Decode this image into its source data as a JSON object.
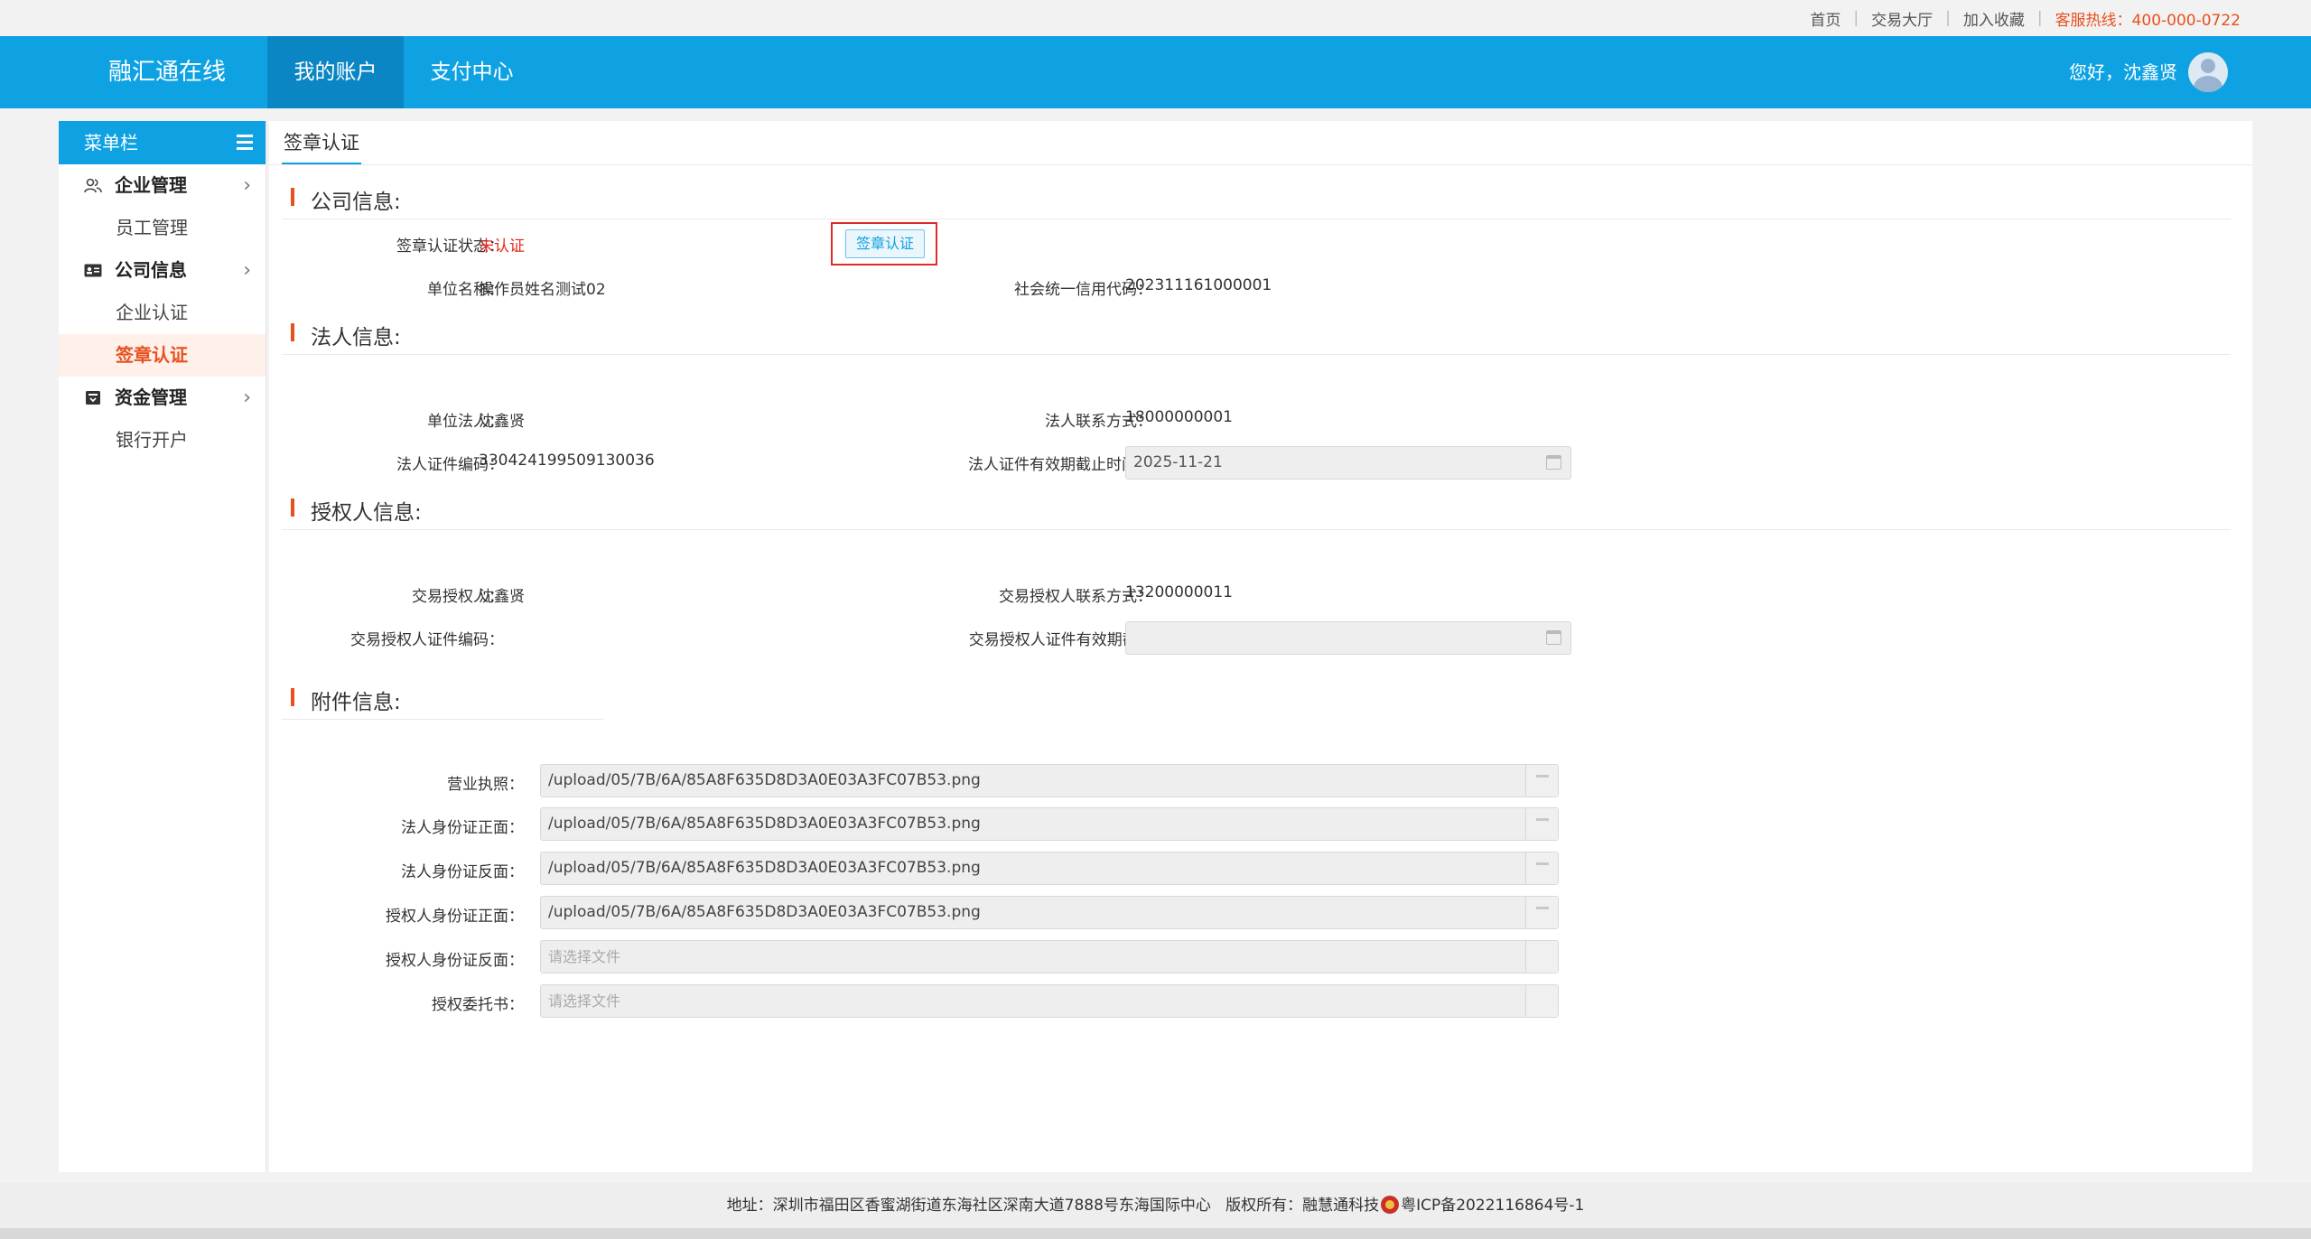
{
  "toplinks": {
    "home": "首页",
    "trading_hall": "交易大厅",
    "favorite": "加入收藏",
    "hotline": "客服热线：400-000-0722"
  },
  "header": {
    "logo": "融汇通在线",
    "nav": [
      "我的账户",
      "支付中心"
    ],
    "greeting": "您好，沈鑫贤",
    "colors": {
      "brand": "#0ea2e3",
      "active_nav": "#0a86c4",
      "accent": "#e8501e"
    }
  },
  "sidebar": {
    "title": "菜单栏",
    "groups": [
      {
        "label": "企业管理",
        "icon": "users-icon",
        "items": [
          "员工管理"
        ]
      },
      {
        "label": "公司信息",
        "icon": "id-card-icon",
        "items": [
          "企业认证",
          "签章认证"
        ]
      },
      {
        "label": "资金管理",
        "icon": "wallet-icon",
        "items": [
          "银行开户"
        ]
      }
    ],
    "active_item": "签章认证"
  },
  "main": {
    "tab": "签章认证",
    "company": {
      "title": "公司信息:",
      "sign_status_label": "签章认证状态：",
      "sign_status_value": "未认证",
      "sign_button": "签章认证",
      "unit_name_label": "单位名称：",
      "unit_name_value": "操作员姓名测试02",
      "credit_code_label": "社会统一信用代码：",
      "credit_code_value": "202311161000001"
    },
    "legal": {
      "title": "法人信息:",
      "legal_person_label": "单位法人：",
      "legal_person_value": "沈鑫贤",
      "phone_label": "法人联系方式：",
      "phone_value": "18000000001",
      "id_label": "法人证件编码：",
      "id_value": "330424199509130036",
      "expiry_label": "法人证件有效期截止时间：",
      "expiry_value": "2025-11-21"
    },
    "authorized": {
      "title": "授权人信息:",
      "person_label": "交易授权人：",
      "person_value": "沈鑫贤",
      "phone_label": "交易授权人联系方式：",
      "phone_value": "13200000011",
      "id_label": "交易授权人证件编码：",
      "expiry_label": "交易授权人证件有效期截..."
    },
    "attachments": {
      "title": "附件信息:",
      "placeholder": "请选择文件",
      "files": [
        {
          "label": "营业执照：",
          "value": "/upload/05/7B/6A/85A8F635D8D3A0E03A3FC07B53.png"
        },
        {
          "label": "法人身份证正面：",
          "value": "/upload/05/7B/6A/85A8F635D8D3A0E03A3FC07B53.png"
        },
        {
          "label": "法人身份证反面：",
          "value": "/upload/05/7B/6A/85A8F635D8D3A0E03A3FC07B53.png"
        },
        {
          "label": "授权人身份证正面：",
          "value": "/upload/05/7B/6A/85A8F635D8D3A0E03A3FC07B53.png"
        },
        {
          "label": "授权人身份证反面：",
          "value": ""
        },
        {
          "label": "授权委托书：",
          "value": ""
        }
      ]
    }
  },
  "footer": {
    "address": "地址：深圳市福田区香蜜湖街道东海社区深南大道7888号东海国际中心",
    "copyright": "版权所有：融慧通科技",
    "icp": "粤ICP备2022116864号-1"
  }
}
